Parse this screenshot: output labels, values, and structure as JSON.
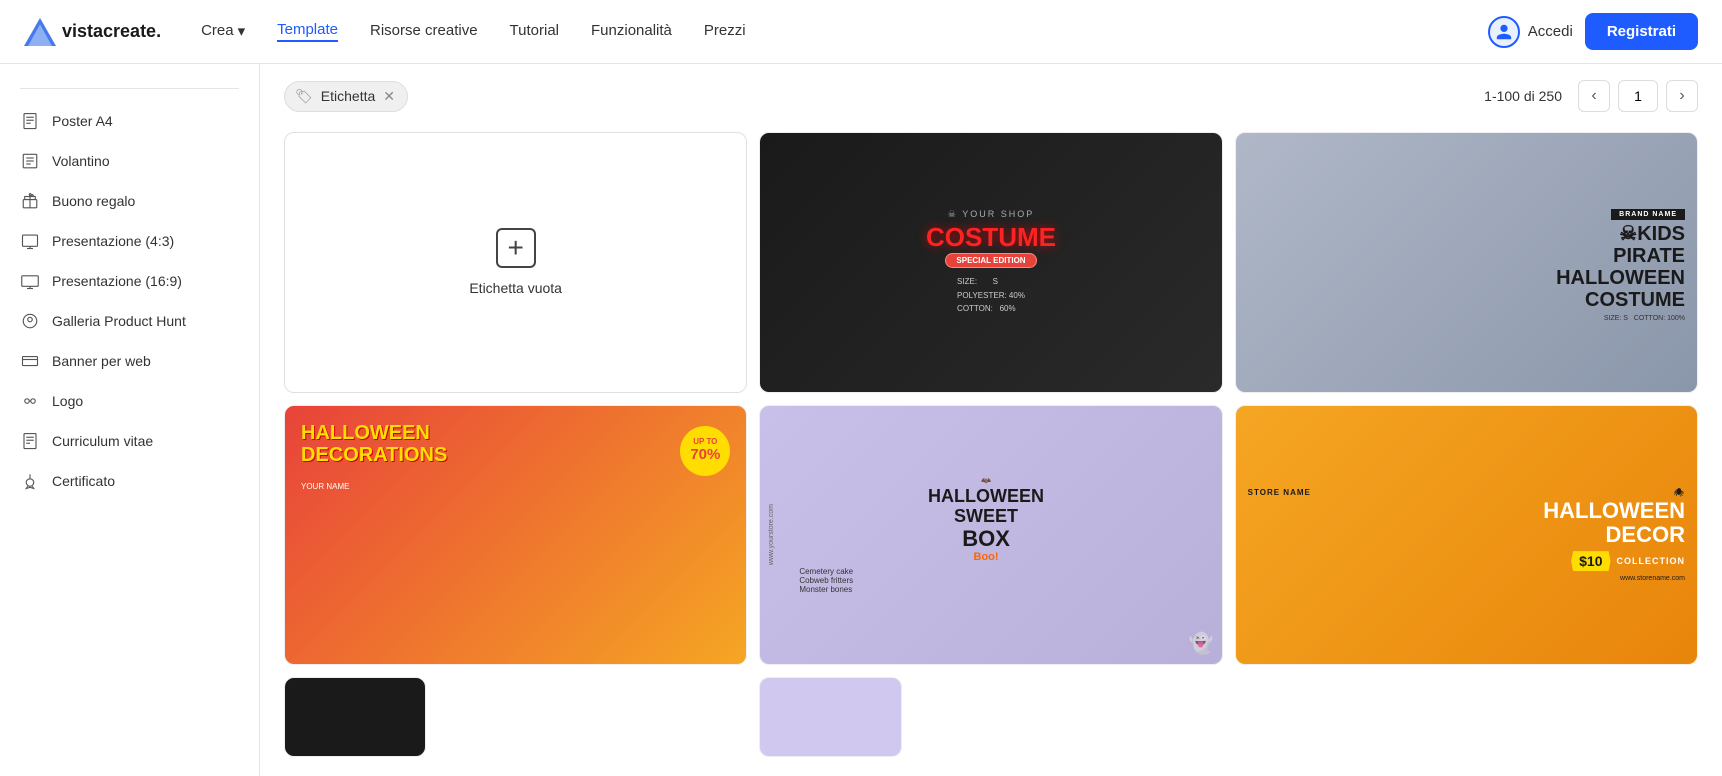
{
  "header": {
    "logo_text": "vistacreate.",
    "nav_items": [
      {
        "id": "crea",
        "label": "Crea",
        "has_dropdown": true,
        "active": false
      },
      {
        "id": "template",
        "label": "Template",
        "active": true
      },
      {
        "id": "risorse",
        "label": "Risorse creative",
        "active": false
      },
      {
        "id": "tutorial",
        "label": "Tutorial",
        "active": false
      },
      {
        "id": "funzionalita",
        "label": "Funzionalità",
        "active": false
      },
      {
        "id": "prezzi",
        "label": "Prezzi",
        "active": false
      }
    ],
    "accedi_label": "Accedi",
    "registrati_label": "Registrati"
  },
  "sidebar": {
    "items": [
      {
        "id": "poster-a4",
        "label": "Poster A4",
        "icon": "poster"
      },
      {
        "id": "volantino",
        "label": "Volantino",
        "icon": "flyer"
      },
      {
        "id": "buono-regalo",
        "label": "Buono regalo",
        "icon": "gift"
      },
      {
        "id": "presentazione-43",
        "label": "Presentazione (4:3)",
        "icon": "presentation"
      },
      {
        "id": "presentazione-169",
        "label": "Presentazione (16:9)",
        "icon": "presentation"
      },
      {
        "id": "galleria-product-hunt",
        "label": "Galleria Product Hunt",
        "icon": "gallery"
      },
      {
        "id": "banner-web",
        "label": "Banner per web",
        "icon": "banner"
      },
      {
        "id": "logo",
        "label": "Logo",
        "icon": "logo"
      },
      {
        "id": "curriculum-vitae",
        "label": "Curriculum vitae",
        "icon": "cv"
      },
      {
        "id": "certificato",
        "label": "Certificato",
        "icon": "certificate"
      }
    ]
  },
  "filter_bar": {
    "tags": [
      {
        "id": "etichetta",
        "label": "Etichetta",
        "removable": true
      }
    ],
    "pagination": {
      "range_text": "1-100 di 250",
      "current_page": "1"
    }
  },
  "grid": {
    "empty_card": {
      "label": "Etichetta vuota",
      "plus_icon": "+"
    },
    "cards": [
      {
        "id": "costume",
        "type": "costume",
        "top_text": "YOUR SHOP",
        "title": "COSTUME",
        "badge": "SPECIAL EDITION",
        "details": [
          "SIZE: S",
          "POLYESTER: 40%",
          "COTTON: 60%"
        ]
      },
      {
        "id": "pirate",
        "type": "pirate",
        "badge": "BRAND NAME",
        "title": "KIDS PIRATE HALLOWEEN COSTUME",
        "details": [
          "SIZE: S  COTTON: 100%"
        ]
      },
      {
        "id": "halloween-deco",
        "type": "halloween-deco",
        "title": "HALLOWEEN DECORATIONS",
        "badge": "UP TO 70%",
        "sub": "YOUR NAME"
      },
      {
        "id": "sweet-box",
        "type": "sweet-box",
        "site": "www.yourstore.com",
        "title": "HALLOWEEN SWEET BOX",
        "boo": "Boo!",
        "items": [
          "Cemetery cake",
          "Cobweb fritters",
          "Monster bones"
        ]
      },
      {
        "id": "halloween-decor-orange",
        "type": "decor-orange",
        "store": "STORE NAME",
        "title": "HALLOWEEN DECOR",
        "price": "$10",
        "sub": "COLLECTION",
        "website": "www.storename.com"
      }
    ],
    "bottom_cards": [
      {
        "id": "bottom-dark",
        "type": "dark"
      },
      {
        "id": "bottom-lavender",
        "type": "lavender"
      }
    ]
  }
}
